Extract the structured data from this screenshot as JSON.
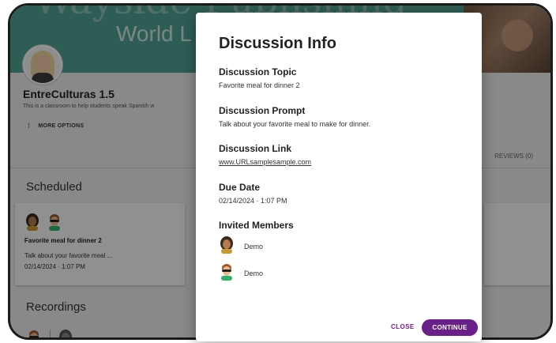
{
  "background": {
    "banner_script": "Wayside Publishing",
    "banner_title": "World L",
    "class_title": "EntreCulturas 1.5",
    "class_description": "This is a classroom to help students speak Spanish w",
    "more_options_label": "MORE OPTIONS",
    "reviews_tab_label": "REVIEWS (0)",
    "scheduled_heading": "Scheduled",
    "recordings_heading": "Recordings",
    "scheduled_card": {
      "title": "Favorite meal for dinner 2",
      "description": "Talk about your favorite meal ...",
      "date": "02/14/2024 · 1:07 PM"
    }
  },
  "modal": {
    "title": "Discussion Info",
    "topic_label": "Discussion Topic",
    "topic_value": "Favorite meal for dinner 2",
    "prompt_label": "Discussion Prompt",
    "prompt_value": "Talk about your favorite meal to make for dinner.",
    "link_label": "Discussion Link",
    "link_value": "www.URLsamplesample.com",
    "due_label": "Due Date",
    "due_value": "02/14/2024 · 1:07 PM",
    "members_label": "Invited Members",
    "members": [
      {
        "name": "Demo",
        "avatar": "dark-hair-avatar-icon"
      },
      {
        "name": "Demo",
        "avatar": "sunglasses-avatar-icon"
      }
    ],
    "close_label": "CLOSE",
    "continue_label": "CONTINUE"
  },
  "colors": {
    "accent": "#6b1f8a",
    "banner": "#4fa191",
    "overlay": "rgba(0,0,0,0.42)"
  }
}
